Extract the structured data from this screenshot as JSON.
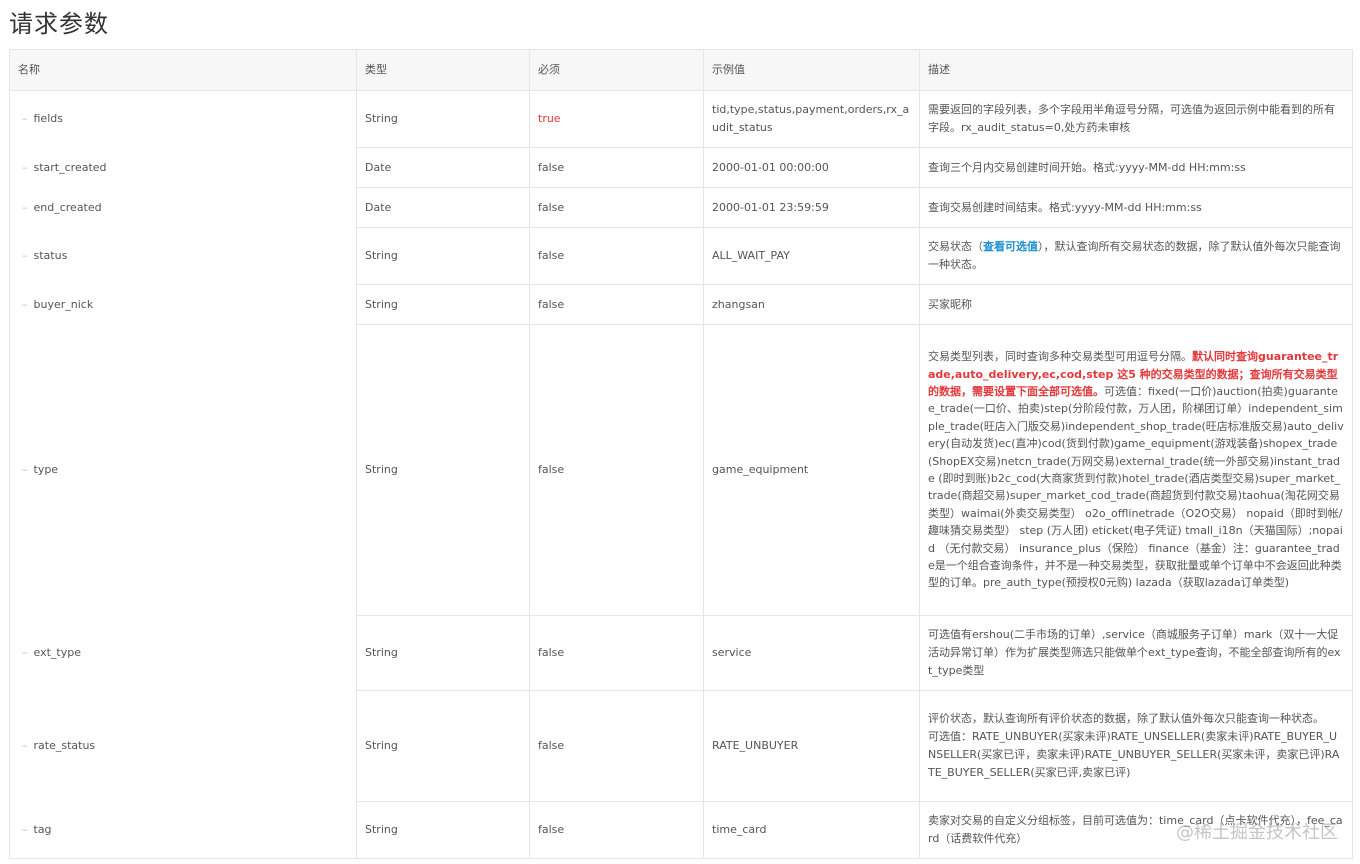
{
  "page": {
    "title": "请求参数"
  },
  "columns": {
    "name": "名称",
    "type": "类型",
    "required": "必须",
    "example": "示例值",
    "desc": "描述"
  },
  "rows": [
    {
      "name": "fields",
      "type": "String",
      "required": "true",
      "example": "tid,type,status,payment,orders,rx_audit_status",
      "desc": "需要返回的字段列表，多个字段用半角逗号分隔，可选值为返回示例中能看到的所有字段。rx_audit_status=0,处方药未审核"
    },
    {
      "name": "start_created",
      "type": "Date",
      "required": "false",
      "example": "2000-01-01 00:00:00",
      "desc": "查询三个月内交易创建时间开始。格式:yyyy-MM-dd HH:mm:ss"
    },
    {
      "name": "end_created",
      "type": "Date",
      "required": "false",
      "example": "2000-01-01 23:59:59",
      "desc": "查询交易创建时间结束。格式:yyyy-MM-dd HH:mm:ss"
    },
    {
      "name": "status",
      "type": "String",
      "required": "false",
      "example": "ALL_WAIT_PAY",
      "desc_a": "交易状态（",
      "desc_link": "查看可选值",
      "desc_b": "），默认查询所有交易状态的数据，除了默认值外每次只能查询一种状态。"
    },
    {
      "name": "buyer_nick",
      "type": "String",
      "required": "false",
      "example": "zhangsan",
      "desc": "买家昵称"
    },
    {
      "name": "type",
      "type": "String",
      "required": "false",
      "example": "game_equipment",
      "desc_a": "交易类型列表，同时查询多种交易类型可用逗号分隔。",
      "desc_red": "默认同时查询guarantee_trade,auto_delivery,ec,cod,step 这5 种的交易类型的数据；查询所有交易类型的数据，需要设置下面全部可选值。",
      "desc_b": "可选值：fixed(一口价)auction(拍卖)guarantee_trade(一口价、拍卖)step(分阶段付款，万人团，阶梯团订单）independent_simple_trade(旺店入门版交易)independent_shop_trade(旺店标准版交易)auto_delivery(自动发货)ec(直冲)cod(货到付款)game_equipment(游戏装备)shopex_trade(ShopEX交易)netcn_trade(万网交易)external_trade(统一外部交易)instant_trade (即时到账)b2c_cod(大商家货到付款)hotel_trade(酒店类型交易)super_market_trade(商超交易)super_market_cod_trade(商超货到付款交易)taohua(淘花网交易类型）waimai(外卖交易类型） o2o_offlinetrade（O2O交易） nopaid（即时到帐/趣味猜交易类型） step (万人团) eticket(电子凭证) tmall_i18n（天猫国际）;nopaid （无付款交易） insurance_plus（保险） finance（基金）注：guarantee_trade是一个组合查询条件，并不是一种交易类型，获取批量或单个订单中不会返回此种类型的订单。pre_auth_type(预授权0元购) lazada（获取lazada订单类型)"
    },
    {
      "name": "ext_type",
      "type": "String",
      "required": "false",
      "example": "service",
      "desc": "可选值有ershou(二手市场的订单）,service（商城服务子订单）mark（双十一大促活动异常订单）作为扩展类型筛选只能做单个ext_type查询，不能全部查询所有的ext_type类型"
    },
    {
      "name": "rate_status",
      "type": "String",
      "required": "false",
      "example": "RATE_UNBUYER",
      "desc_a": "评价状态，默认查询所有评价状态的数据，除了默认值外每次只能查询一种状态。",
      "desc_b": "可选值：RATE_UNBUYER(买家未评)RATE_UNSELLER(卖家未评)RATE_BUYER_UNSELLER(买家已评，卖家未评)RATE_UNBUYER_SELLER(买家未评，卖家已评)RATE_BUYER_SELLER(买家已评,卖家已评)"
    },
    {
      "name": "tag",
      "type": "String",
      "required": "false",
      "example": "time_card",
      "desc": "卖家对交易的自定义分组标签，目前可选值为：time_card（点卡软件代充），fee_card（话费软件代充）"
    }
  ],
  "watermark": "@稀土掘金技术社区"
}
